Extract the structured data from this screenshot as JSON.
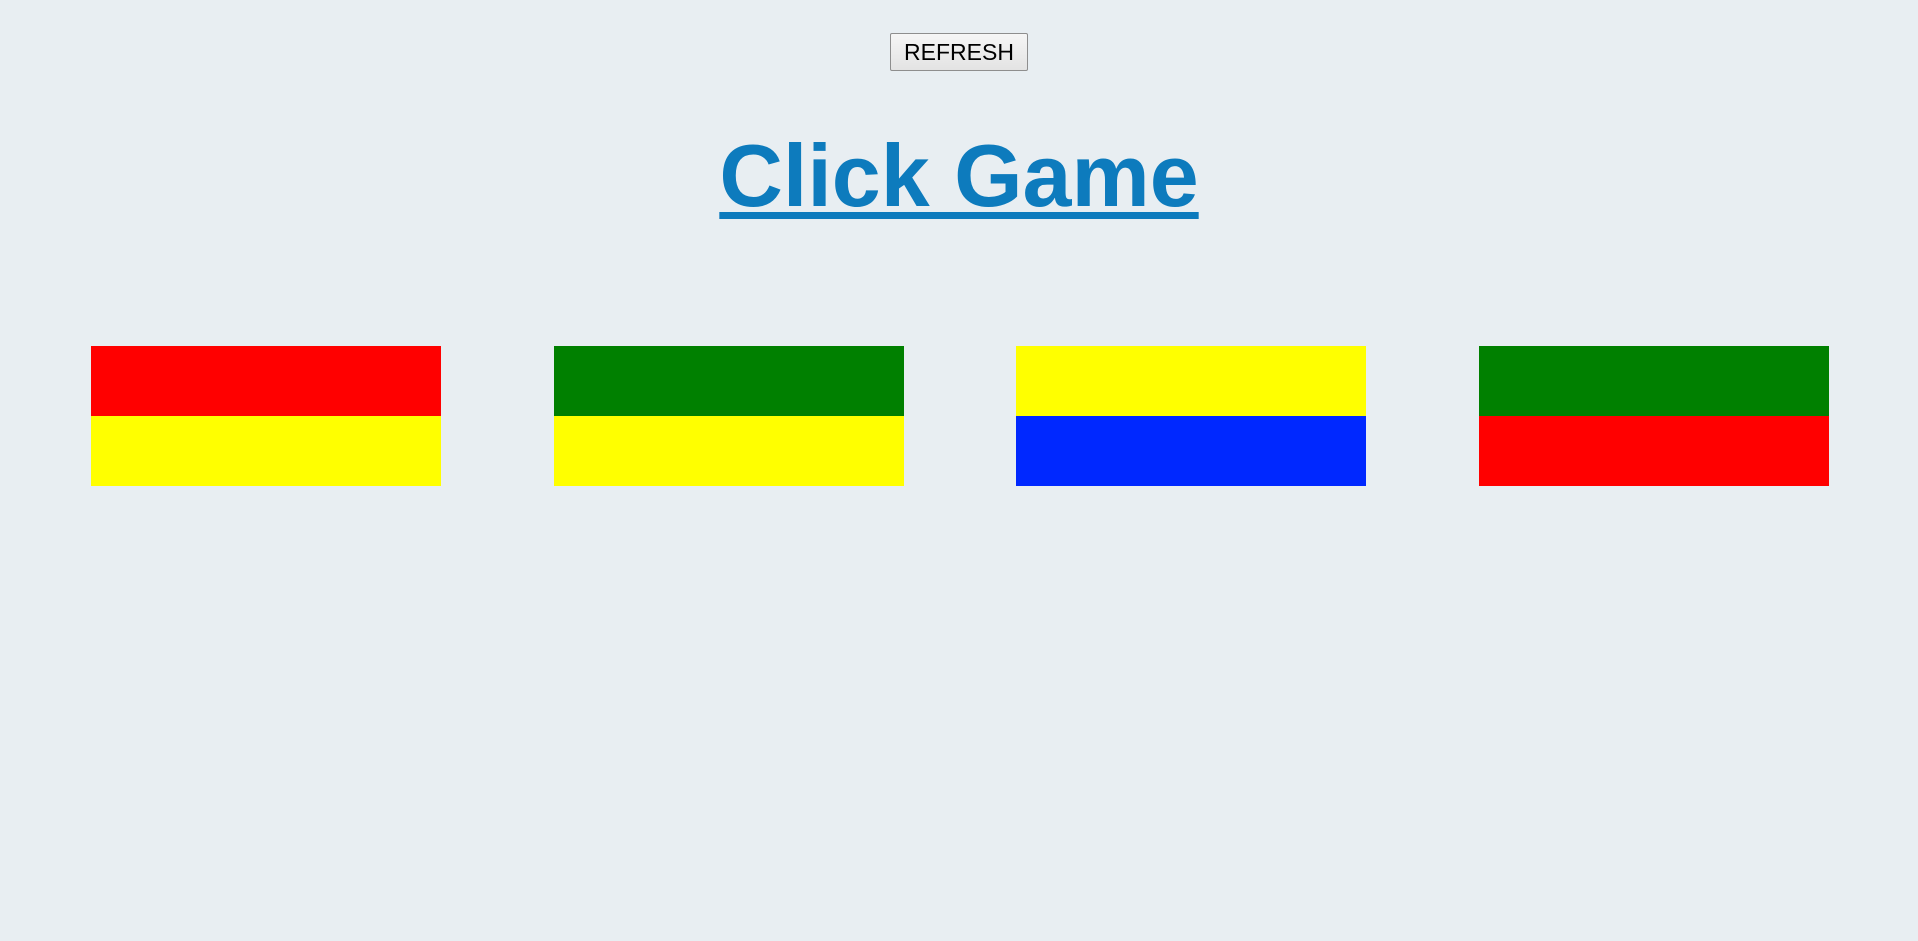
{
  "controls": {
    "refresh_label": "REFRESH"
  },
  "header": {
    "title": "Click Game",
    "title_color": "#0d7bbd"
  },
  "tiles": [
    {
      "top_color": "#ff0000",
      "bottom_color": "#ffff00"
    },
    {
      "top_color": "#008000",
      "bottom_color": "#ffff00"
    },
    {
      "top_color": "#ffff00",
      "bottom_color": "#0028ff"
    },
    {
      "top_color": "#008000",
      "bottom_color": "#ff0000"
    }
  ]
}
